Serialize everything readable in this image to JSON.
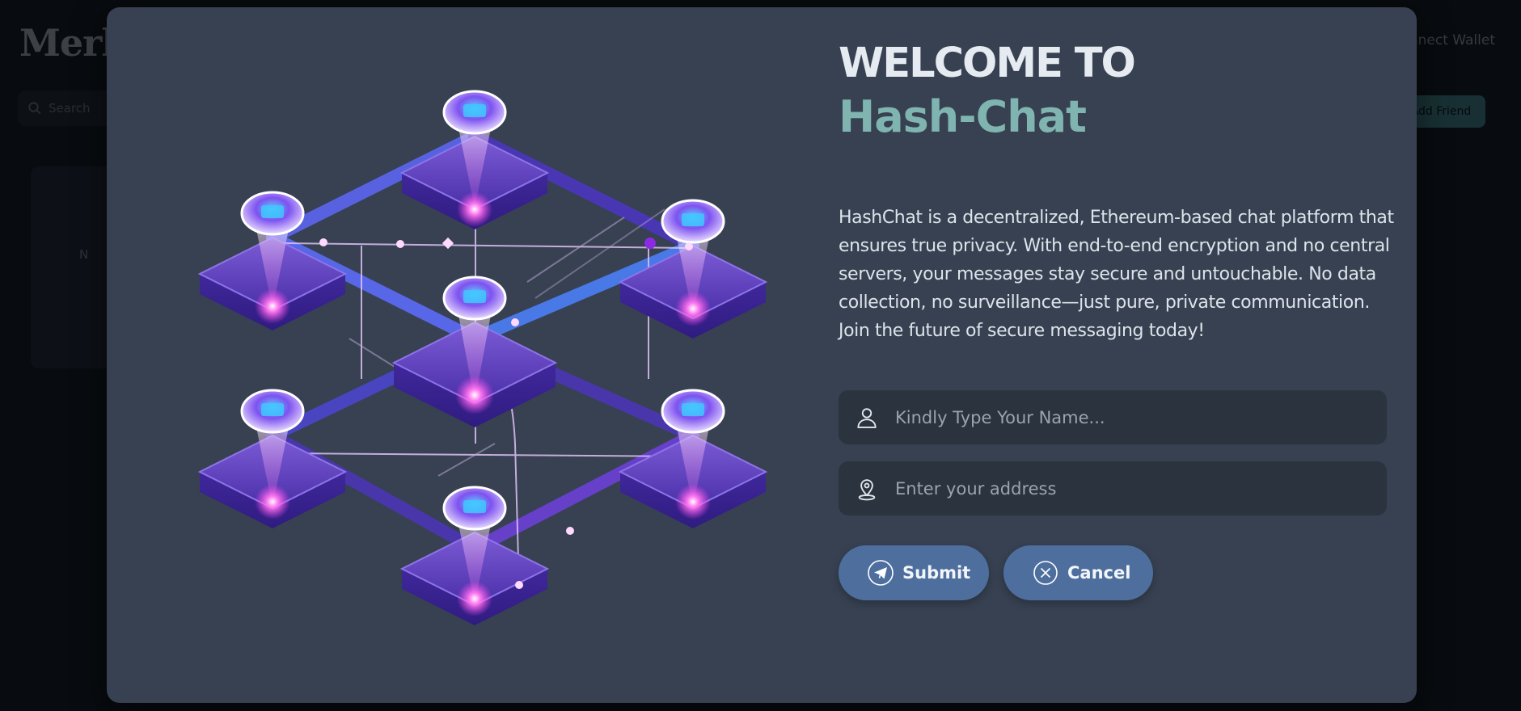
{
  "background": {
    "logo": "Merk",
    "wallet_label": "Connect Wallet",
    "search_placeholder": "Search",
    "add_button": "Add Friend",
    "card_text": "N"
  },
  "modal": {
    "title_line1": "WELCOME TO",
    "title_line2": "Hash-Chat",
    "description": "HashChat is a decentralized, Ethereum-based chat platform that ensures true privacy. With end-to-end encryption and no central servers, your messages stay secure and untouchable. No data collection, no surveillance—just pure, private communication. Join the future of secure messaging today!",
    "name_field": {
      "placeholder": "Kindly Type Your Name...",
      "value": "",
      "icon": "user-icon"
    },
    "address_field": {
      "placeholder": "Enter your address",
      "value": "",
      "icon": "map-pin-icon"
    },
    "submit_button": {
      "label": "Submit",
      "icon": "paper-plane-icon"
    },
    "cancel_button": {
      "label": "Cancel",
      "icon": "close-circle-icon"
    },
    "illustration": "network-nodes-illustration"
  },
  "colors": {
    "modal_bg": "#374151",
    "brand_accent": "#7fb4b0",
    "button_bg": "#4e6f9e",
    "input_bg": "#2b333e"
  }
}
